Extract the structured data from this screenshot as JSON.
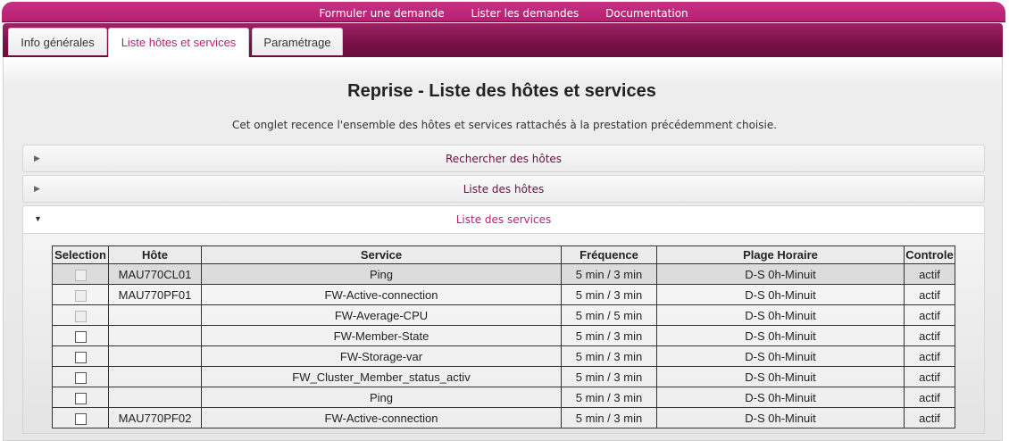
{
  "topnav": {
    "links": [
      "Formuler une demande",
      "Lister les demandes",
      "Documentation"
    ]
  },
  "tabs": [
    "Info générales",
    "Liste hôtes et services",
    "Paramétrage"
  ],
  "active_tab": 1,
  "page": {
    "title": "Reprise - Liste des hôtes et services",
    "description": "Cet onglet recence l'ensemble des hôtes et services rattachés à la prestation précédemment choisie."
  },
  "accordion": {
    "sections": [
      "Rechercher des hôtes",
      "Liste des hôtes",
      "Liste des services"
    ],
    "open_index": 2
  },
  "table": {
    "headers": [
      "Selection",
      "Hôte",
      "Service",
      "Fréquence",
      "Plage Horaire",
      "Controle"
    ],
    "rows": [
      {
        "checkbox": "disabled",
        "host": "MAU770CL01",
        "service": "Ping",
        "freq": "5 min / 3 min",
        "plage": "D-S 0h-Minuit",
        "controle": "actif"
      },
      {
        "checkbox": "disabled",
        "host": "MAU770PF01",
        "service": "FW-Active-connection",
        "freq": "5 min / 3 min",
        "plage": "D-S 0h-Minuit",
        "controle": "actif"
      },
      {
        "checkbox": "disabled",
        "host": "",
        "service": "FW-Average-CPU",
        "freq": "5 min / 5 min",
        "plage": "D-S 0h-Minuit",
        "controle": "actif"
      },
      {
        "checkbox": "enabled",
        "host": "",
        "service": "FW-Member-State",
        "freq": "5 min / 3 min",
        "plage": "D-S 0h-Minuit",
        "controle": "actif"
      },
      {
        "checkbox": "enabled",
        "host": "",
        "service": "FW-Storage-var",
        "freq": "5 min / 3 min",
        "plage": "D-S 0h-Minuit",
        "controle": "actif"
      },
      {
        "checkbox": "enabled",
        "host": "",
        "service": "FW_Cluster_Member_status_activ",
        "freq": "5 min / 3 min",
        "plage": "D-S 0h-Minuit",
        "controle": "actif"
      },
      {
        "checkbox": "enabled",
        "host": "",
        "service": "Ping",
        "freq": "5 min / 3 min",
        "plage": "D-S 0h-Minuit",
        "controle": "actif"
      },
      {
        "checkbox": "enabled",
        "host": "MAU770PF02",
        "service": "FW-Active-connection",
        "freq": "5 min / 3 min",
        "plage": "D-S 0h-Minuit",
        "controle": "actif"
      }
    ]
  },
  "colors": {
    "accent": "#b81f72",
    "nav_dark": "#7a1048"
  }
}
